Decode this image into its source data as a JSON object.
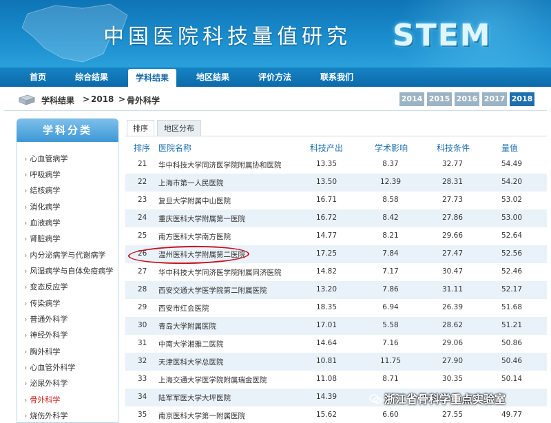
{
  "banner": {
    "title": "中国医院科技量值研究",
    "logo": "STEM"
  },
  "nav": {
    "items": [
      {
        "label": "首页"
      },
      {
        "label": "综合结果"
      },
      {
        "label": "学科结果"
      },
      {
        "label": "地区结果"
      },
      {
        "label": "评价方法"
      },
      {
        "label": "联系我们"
      }
    ],
    "active": "学科结果"
  },
  "breadcrumb": {
    "root": "学科结果",
    "sep1": ">",
    "year": "2018",
    "sep2": ">",
    "current": "骨外科学"
  },
  "years": [
    "2014",
    "2015",
    "2016",
    "2017",
    "2018"
  ],
  "active_year": "2018",
  "sidebar": {
    "title": "学科分类",
    "items": [
      {
        "label": "心血管病学"
      },
      {
        "label": "呼吸病学"
      },
      {
        "label": "结核病学"
      },
      {
        "label": "消化病学"
      },
      {
        "label": "血液病学"
      },
      {
        "label": "肾脏病学"
      },
      {
        "label": "内分泌病学与代谢病学"
      },
      {
        "label": "风湿病学与自体免疫病学"
      },
      {
        "label": "变态反应学"
      },
      {
        "label": "传染病学"
      },
      {
        "label": "普通外科学"
      },
      {
        "label": "神经外科学"
      },
      {
        "label": "胸外科学"
      },
      {
        "label": "心血管外科学"
      },
      {
        "label": "泌尿外科学"
      },
      {
        "label": "骨外科学"
      },
      {
        "label": "烧伤外科学"
      }
    ],
    "active": "骨外科学"
  },
  "tabs": {
    "rank": "排序",
    "region": "地区分布"
  },
  "table": {
    "headers": {
      "rank": "排序",
      "name": "医院名称",
      "output": "科技产出",
      "impact": "学术影响",
      "condition": "科技条件",
      "value": "量值"
    },
    "rows": [
      {
        "rank": "21",
        "name": "华中科技大学同济医学院附属协和医院",
        "output": "13.35",
        "impact": "8.37",
        "condition": "32.77",
        "value": "54.49"
      },
      {
        "rank": "22",
        "name": "上海市第一人民医院",
        "output": "13.50",
        "impact": "12.39",
        "condition": "28.31",
        "value": "54.20"
      },
      {
        "rank": "23",
        "name": "复旦大学附属中山医院",
        "output": "16.71",
        "impact": "8.58",
        "condition": "27.73",
        "value": "53.02"
      },
      {
        "rank": "24",
        "name": "重庆医科大学附属第一医院",
        "output": "16.72",
        "impact": "8.42",
        "condition": "27.86",
        "value": "53.00"
      },
      {
        "rank": "25",
        "name": "南方医科大学南方医院",
        "output": "14.77",
        "impact": "8.21",
        "condition": "29.66",
        "value": "52.64"
      },
      {
        "rank": "26",
        "name": "温州医科大学附属第二医院",
        "output": "17.25",
        "impact": "7.84",
        "condition": "27.47",
        "value": "52.56"
      },
      {
        "rank": "27",
        "name": "华中科技大学同济医学院附属同济医院",
        "output": "14.82",
        "impact": "7.17",
        "condition": "30.47",
        "value": "52.46"
      },
      {
        "rank": "28",
        "name": "西安交通大学医学院第二附属医院",
        "output": "13.20",
        "impact": "7.86",
        "condition": "31.11",
        "value": "52.17"
      },
      {
        "rank": "29",
        "name": "西安市红会医院",
        "output": "18.35",
        "impact": "6.94",
        "condition": "26.39",
        "value": "51.68"
      },
      {
        "rank": "30",
        "name": "青岛大学附属医院",
        "output": "17.01",
        "impact": "5.58",
        "condition": "28.62",
        "value": "51.21"
      },
      {
        "rank": "31",
        "name": "中南大学湘雅二医院",
        "output": "14.64",
        "impact": "7.16",
        "condition": "29.06",
        "value": "50.86"
      },
      {
        "rank": "32",
        "name": "天津医科大学总医院",
        "output": "10.81",
        "impact": "11.75",
        "condition": "27.90",
        "value": "50.46"
      },
      {
        "rank": "33",
        "name": "上海交通大学医学院附属瑞金医院",
        "output": "11.08",
        "impact": "8.71",
        "condition": "30.35",
        "value": "50.14"
      },
      {
        "rank": "34",
        "name": "陆军军医大学大坪医院",
        "output": "14.39",
        "impact": "",
        "condition": "",
        "value": ""
      },
      {
        "rank": "35",
        "name": "南京医科大学第一附属医院",
        "output": "15.62",
        "impact": "6.60",
        "condition": "27.55",
        "value": "49.77"
      }
    ],
    "highlighted_rank": "26"
  },
  "watermark": "浙江省骨科学重点实验室",
  "colors": {
    "accent": "#1d6fae",
    "highlight": "#c8121f",
    "active_side": "#d4231b"
  }
}
